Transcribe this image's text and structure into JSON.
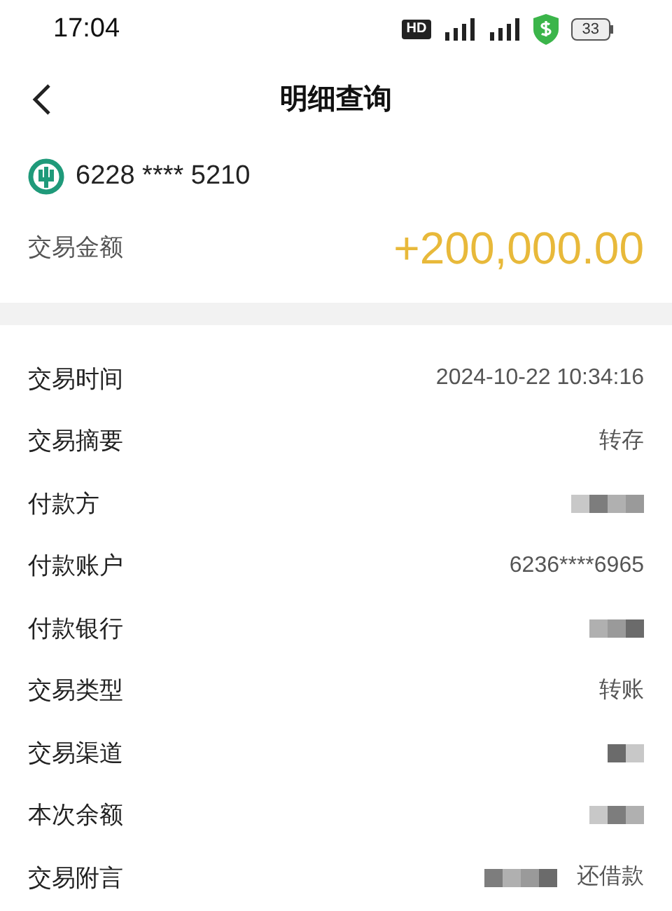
{
  "status_bar": {
    "time": "17:04",
    "hd": "HD",
    "battery": "33"
  },
  "header": {
    "title": "明细查询"
  },
  "account": {
    "card_number": "6228 **** 5210",
    "amount_label": "交易金额",
    "amount": "+200,000.00"
  },
  "details": [
    {
      "label": "交易时间",
      "value": "2024-10-22 10:34:16",
      "redacted": false
    },
    {
      "label": "交易摘要",
      "value": "转存",
      "redacted": false
    },
    {
      "label": "付款方",
      "redacted": true
    },
    {
      "label": "付款账户",
      "value": "6236****6965",
      "redacted": false
    },
    {
      "label": "付款银行",
      "redacted": true
    },
    {
      "label": "交易类型",
      "value": "转账",
      "redacted": false
    },
    {
      "label": "交易渠道",
      "redacted": true
    },
    {
      "label": "本次余额",
      "redacted": true
    },
    {
      "label": "交易附言",
      "value": "还借款",
      "redacted": true
    }
  ]
}
